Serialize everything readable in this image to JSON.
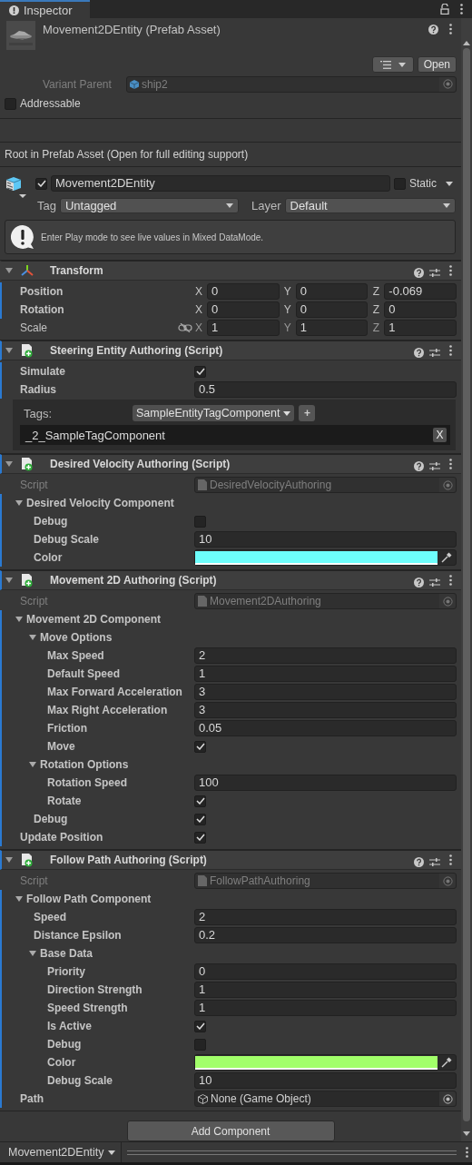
{
  "tab": {
    "title": "Inspector"
  },
  "header": {
    "title": "Movement2DEntity (Prefab Asset)",
    "open_button": "Open",
    "variant_label": "Variant Parent",
    "variant_value": "ship2",
    "addressable": {
      "label": "Addressable",
      "checked": false
    }
  },
  "root_note": "Root in Prefab Asset (Open for full editing support)",
  "gameobject": {
    "active": true,
    "name": "Movement2DEntity",
    "static": {
      "label": "Static",
      "checked": false
    },
    "tag_label": "Tag",
    "tag": "Untagged",
    "layer_label": "Layer",
    "layer": "Default",
    "info": "Enter Play mode to see live values in Mixed DataMode."
  },
  "components": [
    {
      "kind": "transform",
      "title": "Transform",
      "expanded": true,
      "overridden": false,
      "rows": [
        {
          "kind": "vector",
          "label": "Position",
          "overridden": true,
          "axes": [
            {
              "axis": "X",
              "value": "0"
            },
            {
              "axis": "Y",
              "value": "0"
            },
            {
              "axis": "Z",
              "value": "-0.069"
            }
          ]
        },
        {
          "kind": "vector",
          "label": "Rotation",
          "overridden": true,
          "axes": [
            {
              "axis": "X",
              "value": "0"
            },
            {
              "axis": "Y",
              "value": "0"
            },
            {
              "axis": "Z",
              "value": "0"
            }
          ]
        },
        {
          "kind": "vector",
          "label": "Scale",
          "overridden": false,
          "linked": false,
          "axes": [
            {
              "axis": "X",
              "value": "1"
            },
            {
              "axis": "Y",
              "value": "1"
            },
            {
              "axis": "Z",
              "value": "1"
            }
          ]
        }
      ]
    },
    {
      "kind": "script",
      "title": "Steering Entity Authoring (Script)",
      "expanded": true,
      "overridden": true,
      "rows": [
        {
          "kind": "check",
          "label": "Simulate",
          "overridden": true,
          "checked": true
        },
        {
          "kind": "text",
          "label": "Radius",
          "overridden": true,
          "value": "0.5"
        },
        {
          "kind": "tags",
          "label": "Tags:",
          "dropdown": "SampleEntityTagComponent",
          "plus": "+",
          "overridden": true,
          "items": [
            {
              "name": "_2_SampleTagComponent",
              "remove": "X"
            }
          ]
        }
      ]
    },
    {
      "kind": "script",
      "title": "Desired Velocity Authoring (Script)",
      "expanded": true,
      "overridden": true,
      "rows": [
        {
          "kind": "object",
          "label": "Script",
          "overridden": false,
          "disabled": true,
          "value": "DesiredVelocityAuthoring"
        },
        {
          "kind": "foldout",
          "label": "Desired Velocity Component",
          "overridden": true,
          "expanded": true,
          "children": [
            {
              "kind": "check",
              "label": "Debug",
              "overridden": true,
              "checked": false
            },
            {
              "kind": "text",
              "label": "Debug Scale",
              "overridden": true,
              "value": "10"
            },
            {
              "kind": "color",
              "label": "Color",
              "overridden": true,
              "color": "#6dfdfb"
            }
          ]
        }
      ]
    },
    {
      "kind": "script",
      "title": "Movement 2D Authoring (Script)",
      "expanded": true,
      "overridden": true,
      "rows": [
        {
          "kind": "object",
          "label": "Script",
          "overridden": false,
          "disabled": true,
          "value": "Movement2DAuthoring"
        },
        {
          "kind": "foldout",
          "label": "Movement 2D Component",
          "overridden": true,
          "expanded": true,
          "children": [
            {
              "kind": "foldout",
              "label": "Move Options",
              "overridden": true,
              "expanded": true,
              "children": [
                {
                  "kind": "text",
                  "label": "Max Speed",
                  "overridden": true,
                  "value": "2"
                },
                {
                  "kind": "text",
                  "label": "Default Speed",
                  "overridden": true,
                  "value": "1"
                },
                {
                  "kind": "text",
                  "label": "Max Forward Acceleration",
                  "overridden": true,
                  "value": "3"
                },
                {
                  "kind": "text",
                  "label": "Max Right Acceleration",
                  "overridden": true,
                  "value": "3"
                },
                {
                  "kind": "text",
                  "label": "Friction",
                  "overridden": true,
                  "value": "0.05"
                },
                {
                  "kind": "check",
                  "label": "Move",
                  "overridden": true,
                  "checked": true
                }
              ]
            },
            {
              "kind": "foldout",
              "label": "Rotation Options",
              "overridden": true,
              "expanded": true,
              "children": [
                {
                  "kind": "text",
                  "label": "Rotation Speed",
                  "overridden": true,
                  "value": "100"
                },
                {
                  "kind": "check",
                  "label": "Rotate",
                  "overridden": true,
                  "checked": true
                }
              ]
            },
            {
              "kind": "check",
              "label": "Debug",
              "overridden": true,
              "checked": true
            }
          ]
        },
        {
          "kind": "check",
          "label": "Update Position",
          "overridden": true,
          "checked": true
        }
      ]
    },
    {
      "kind": "script",
      "title": "Follow Path Authoring (Script)",
      "expanded": true,
      "overridden": true,
      "rows": [
        {
          "kind": "object",
          "label": "Script",
          "overridden": false,
          "disabled": true,
          "value": "FollowPathAuthoring"
        },
        {
          "kind": "foldout",
          "label": "Follow Path Component",
          "overridden": true,
          "expanded": true,
          "children": [
            {
              "kind": "text",
              "label": "Speed",
              "overridden": true,
              "value": "2"
            },
            {
              "kind": "text",
              "label": "Distance Epsilon",
              "overridden": true,
              "value": "0.2"
            },
            {
              "kind": "foldout",
              "label": "Base Data",
              "overridden": true,
              "expanded": true,
              "children": [
                {
                  "kind": "text",
                  "label": "Priority",
                  "overridden": true,
                  "value": "0"
                },
                {
                  "kind": "text",
                  "label": "Direction Strength",
                  "overridden": true,
                  "value": "1"
                },
                {
                  "kind": "text",
                  "label": "Speed Strength",
                  "overridden": true,
                  "value": "1"
                },
                {
                  "kind": "check",
                  "label": "Is Active",
                  "overridden": true,
                  "checked": true
                },
                {
                  "kind": "check",
                  "label": "Debug",
                  "overridden": true,
                  "checked": false
                },
                {
                  "kind": "color",
                  "label": "Color",
                  "overridden": true,
                  "color": "#a2ff6a"
                },
                {
                  "kind": "text",
                  "label": "Debug Scale",
                  "overridden": true,
                  "value": "10"
                }
              ]
            }
          ]
        },
        {
          "kind": "object",
          "label": "Path",
          "overridden": true,
          "disabled": false,
          "value": "None (Game Object)"
        }
      ]
    }
  ],
  "add_button": "Add Component",
  "footer": {
    "title": "Movement2DEntity"
  }
}
